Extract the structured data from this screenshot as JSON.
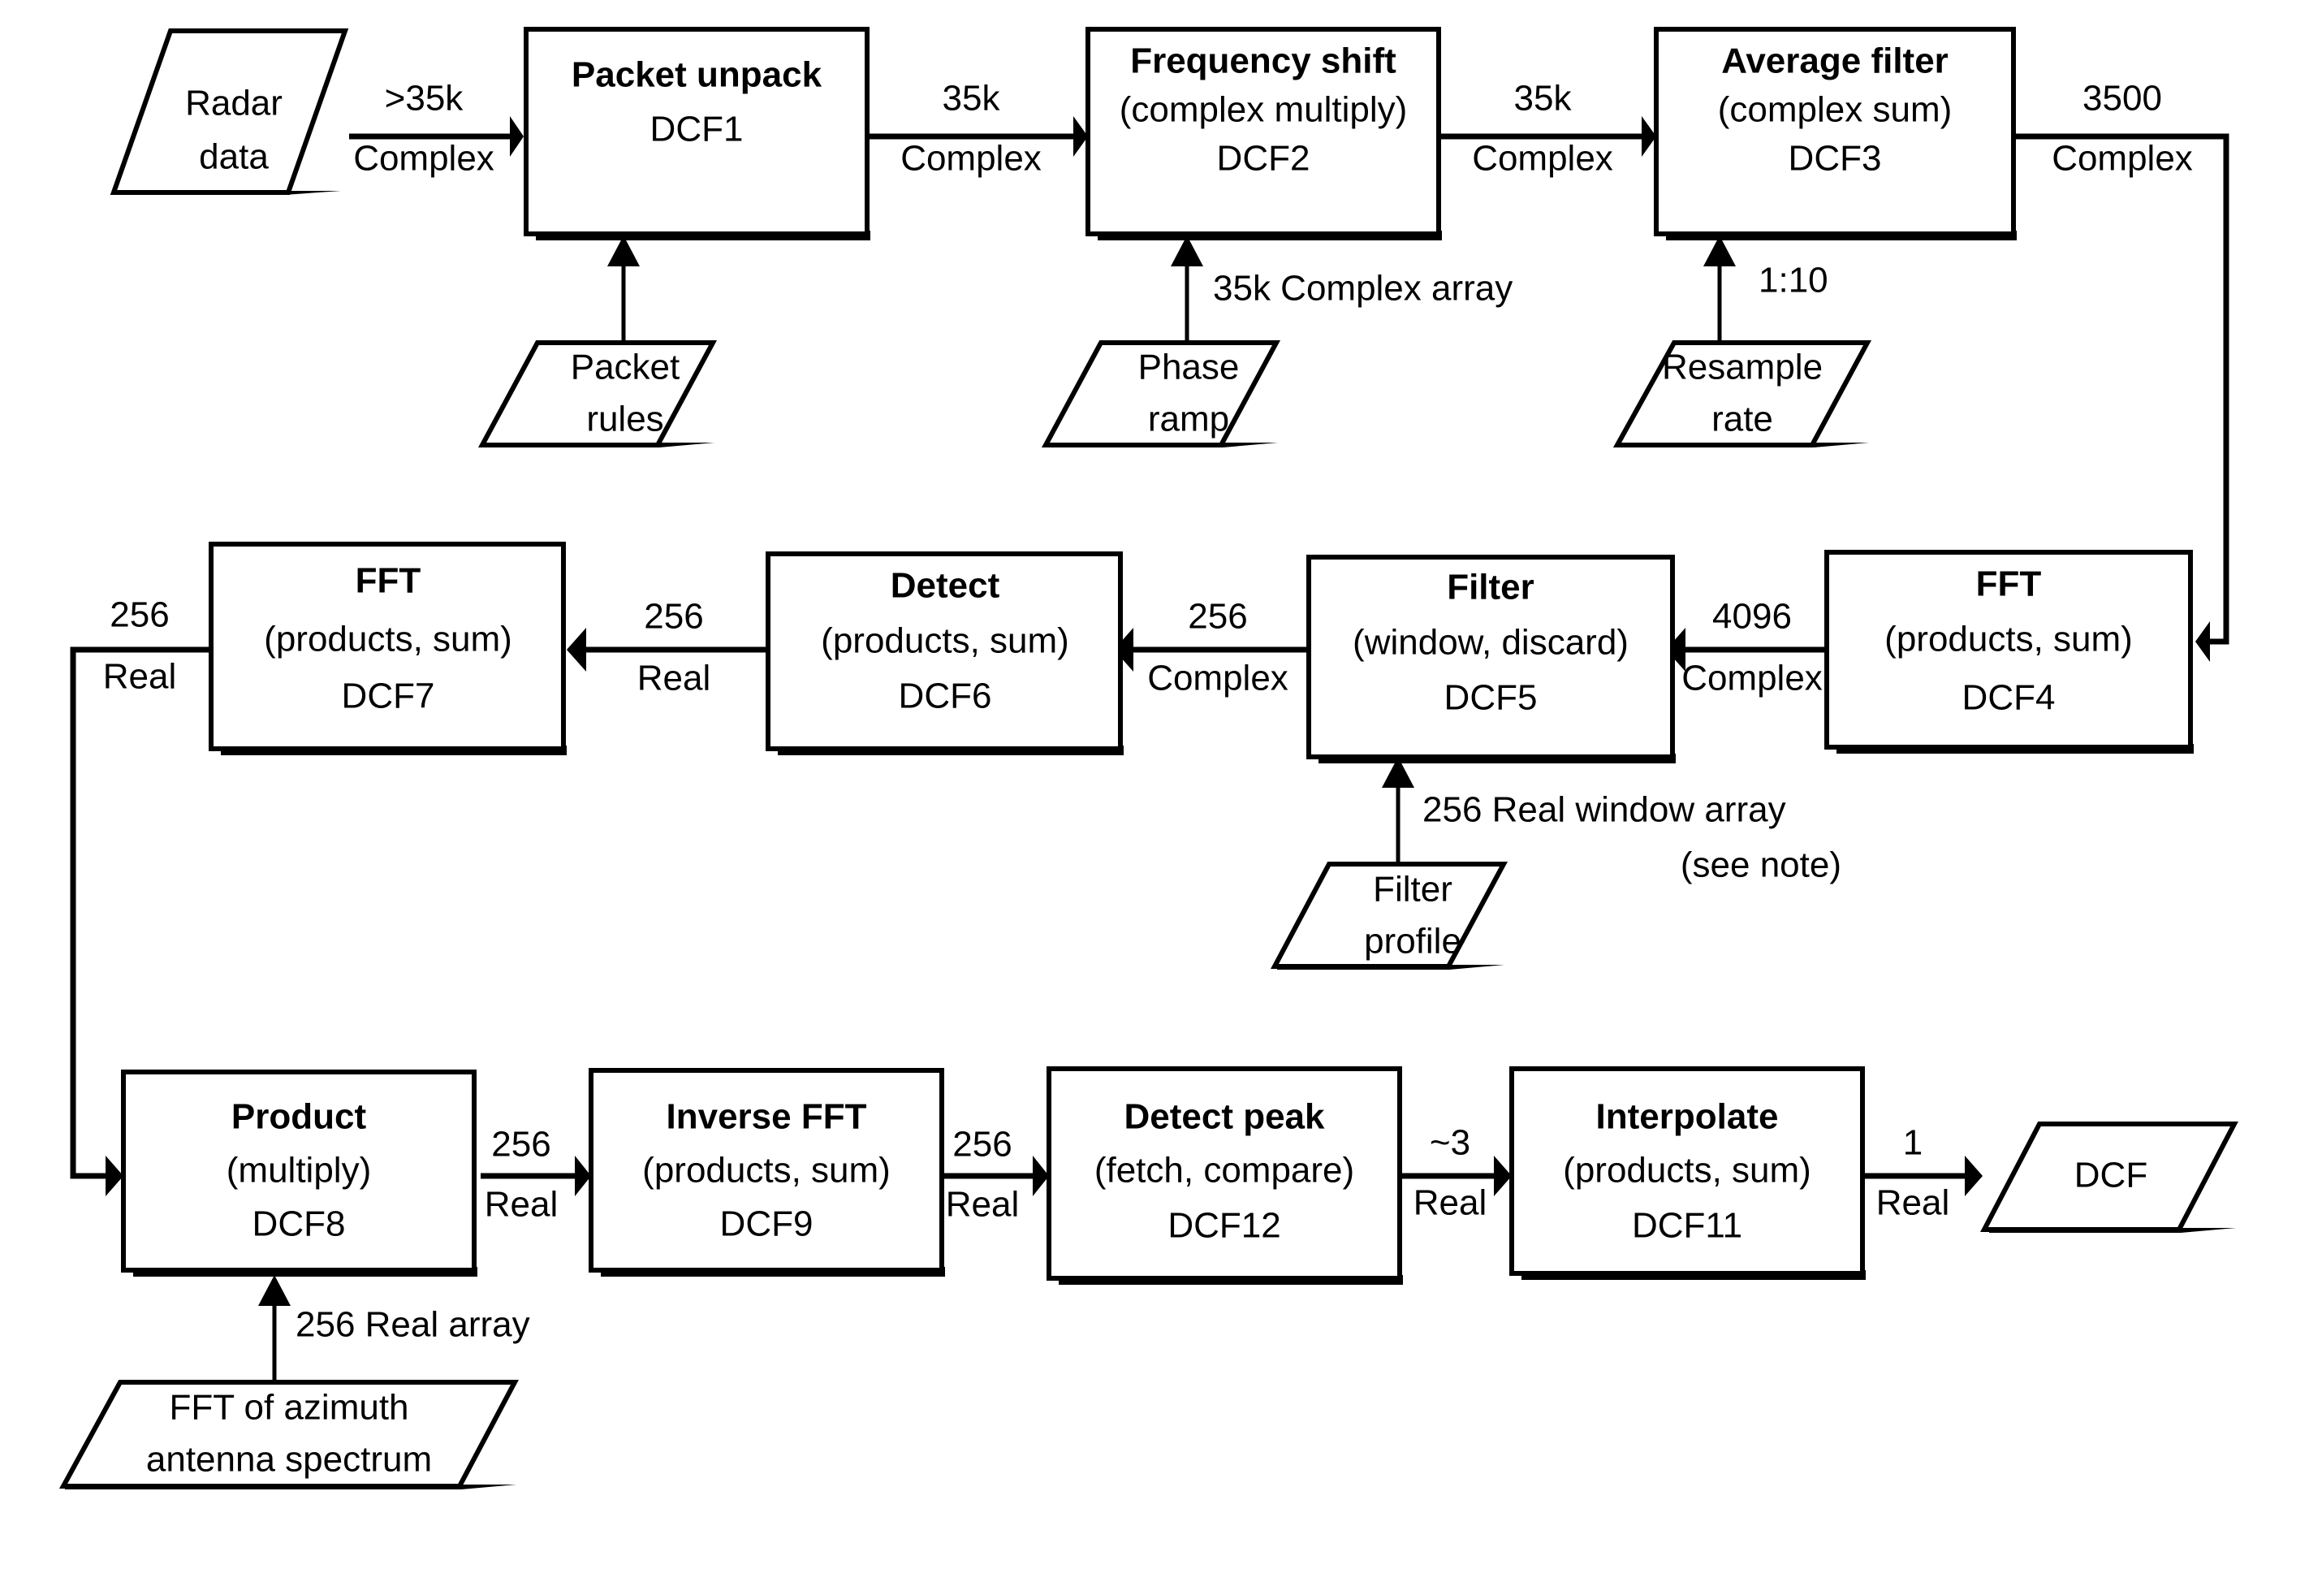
{
  "diagram": {
    "type": "flowchart",
    "title": "Radar data processing DCF pipeline",
    "processes": [
      {
        "id": "dcf1",
        "title": "Packet unpack",
        "sub": "",
        "code": "DCF1"
      },
      {
        "id": "dcf2",
        "title": "Frequency shift",
        "sub": "(complex multiply)",
        "code": "DCF2"
      },
      {
        "id": "dcf3",
        "title": "Average filter",
        "sub": "(complex sum)",
        "code": "DCF3"
      },
      {
        "id": "dcf4",
        "title": "FFT",
        "sub": "(products, sum)",
        "code": "DCF4"
      },
      {
        "id": "dcf5",
        "title": "Filter",
        "sub": "(window, discard)",
        "code": "DCF5"
      },
      {
        "id": "dcf6",
        "title": "Detect",
        "sub": "(products, sum)",
        "code": "DCF6"
      },
      {
        "id": "dcf7",
        "title": "FFT",
        "sub": "(products, sum)",
        "code": "DCF7"
      },
      {
        "id": "dcf8",
        "title": "Product",
        "sub": "(multiply)",
        "code": "DCF8"
      },
      {
        "id": "dcf9",
        "title": "Inverse FFT",
        "sub": "(products, sum)",
        "code": "DCF9"
      },
      {
        "id": "dcf12",
        "title": "Detect peak",
        "sub": "(fetch, compare)",
        "code": "DCF12"
      },
      {
        "id": "dcf11",
        "title": "Interpolate",
        "sub": "(products, sum)",
        "code": "DCF11"
      }
    ],
    "io_nodes": [
      {
        "id": "radar_data",
        "line1": "Radar",
        "line2": "data"
      },
      {
        "id": "packet_rules",
        "line1": "Packet",
        "line2": "rules"
      },
      {
        "id": "phase_ramp",
        "line1": "Phase",
        "line2": "ramp"
      },
      {
        "id": "resample",
        "line1": "Resample",
        "line2": "rate"
      },
      {
        "id": "filter_prof",
        "line1": "Filter",
        "line2": "profile"
      },
      {
        "id": "azimuth_fft",
        "line1": "FFT of azimuth",
        "line2": "antenna spectrum"
      },
      {
        "id": "dcf_out",
        "line1": "DCF",
        "line2": ""
      }
    ],
    "edge_labels": [
      {
        "id": "e_radar_dcf1",
        "count": ">35k",
        "kind": "Complex"
      },
      {
        "id": "e_dcf1_dcf2",
        "count": "35k",
        "kind": "Complex"
      },
      {
        "id": "e_dcf2_dcf3",
        "count": "35k",
        "kind": "Complex"
      },
      {
        "id": "e_dcf3_dcf4",
        "count": "3500",
        "kind": "Complex"
      },
      {
        "id": "e_dcf4_dcf5",
        "count": "4096",
        "kind": "Complex"
      },
      {
        "id": "e_dcf5_dcf6",
        "count": "256",
        "kind": "Complex"
      },
      {
        "id": "e_dcf6_dcf7",
        "count": "256",
        "kind": "Real"
      },
      {
        "id": "e_dcf7_dcf8",
        "count": "256",
        "kind": "Real"
      },
      {
        "id": "e_dcf8_dcf9",
        "count": "256",
        "kind": "Real"
      },
      {
        "id": "e_dcf9_dcf12",
        "count": "256",
        "kind": "Real"
      },
      {
        "id": "e_dcf12_dcf11",
        "count": "~3",
        "kind": "Real"
      },
      {
        "id": "e_dcf11_out",
        "count": "1",
        "kind": "Real"
      }
    ],
    "annotations": [
      {
        "id": "a_packet_rules",
        "text": ""
      },
      {
        "id": "a_phase_ramp",
        "text": "35k Complex array"
      },
      {
        "id": "a_resample",
        "text": "1:10"
      },
      {
        "id": "a_filter_prof_1",
        "text": "256 Real window array"
      },
      {
        "id": "a_filter_prof_2",
        "text": "(see note)"
      },
      {
        "id": "a_azimuth",
        "text": "256 Real array"
      }
    ],
    "colors": {
      "stroke": "#000000",
      "fill": "#ffffff",
      "text": "#000000"
    }
  }
}
